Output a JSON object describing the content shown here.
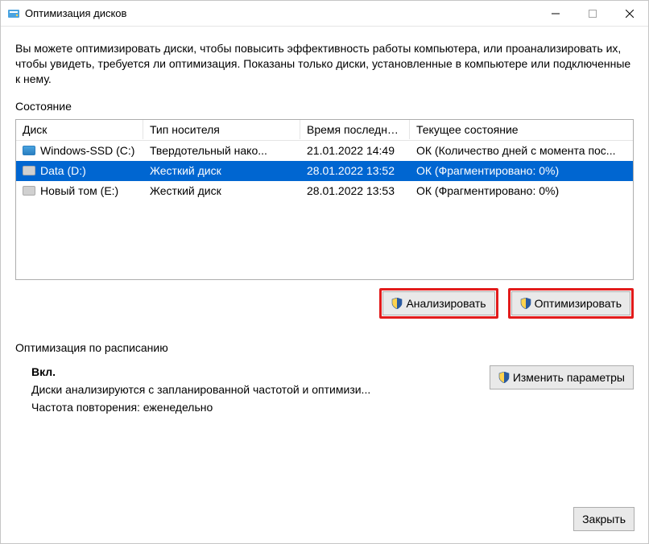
{
  "window": {
    "title": "Оптимизация дисков"
  },
  "intro": "Вы можете оптимизировать диски, чтобы повысить эффективность работы  компьютера, или проанализировать их, чтобы увидеть, требуется ли оптимизация. Показаны только диски, установленные в компьютере или подключенные к нему.",
  "state_label": "Состояние",
  "columns": {
    "disk": "Диск",
    "type": "Тип носителя",
    "time": "Время последне...",
    "state": "Текущее состояние"
  },
  "rows": [
    {
      "name": "Windows-SSD (C:)",
      "type": "Твердотельный нако...",
      "time": "21.01.2022 14:49",
      "state": "ОК (Количество дней с момента пос...",
      "selected": false,
      "ssd": true
    },
    {
      "name": "Data (D:)",
      "type": "Жесткий диск",
      "time": "28.01.2022 13:52",
      "state": "ОК (Фрагментировано: 0%)",
      "selected": true,
      "ssd": false
    },
    {
      "name": "Новый том (E:)",
      "type": "Жесткий диск",
      "time": "28.01.2022 13:53",
      "state": "ОК (Фрагментировано: 0%)",
      "selected": false,
      "ssd": false
    }
  ],
  "buttons": {
    "analyze": "Анализировать",
    "optimize": "Оптимизировать",
    "change": "Изменить параметры",
    "close": "Закрыть"
  },
  "schedule": {
    "label": "Оптимизация по расписанию",
    "status": "Вкл.",
    "line1": "Диски анализируются с запланированной частотой и оптимизи...",
    "line2": "Частота повторения: еженедельно"
  }
}
